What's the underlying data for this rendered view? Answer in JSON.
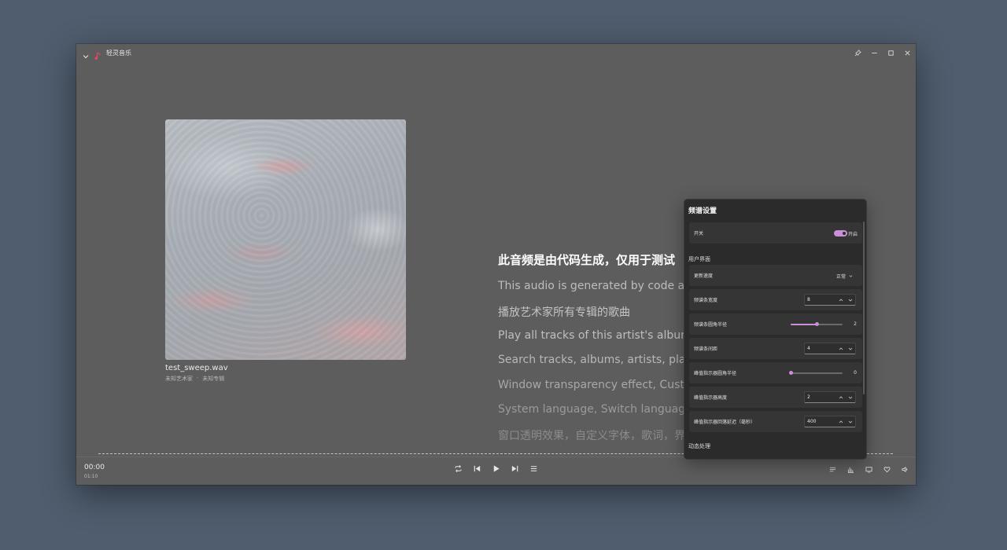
{
  "app": {
    "title": "轻灵音乐"
  },
  "track": {
    "name": "test_sweep.wav",
    "artist": "未知艺术家",
    "separator": "·",
    "album": "未知专辑"
  },
  "lyrics": [
    "此音频是由代码生成，仅用于测试",
    "This audio is generated by code and is",
    "播放艺术家所有专辑的歌曲",
    "Play all tracks of this artist's albums",
    "Search tracks, albums, artists, playlists",
    "Window transparency effect, Custom f",
    "System language, Switch language",
    "窗口透明效果，自定义字体，歌词，界面"
  ],
  "player": {
    "current_time": "00:00",
    "total_time": "01:10"
  },
  "panel": {
    "title": "频谱设置",
    "toggle": {
      "label": "开关",
      "state_text": "开启",
      "on": true
    },
    "section_ui": "用户界面",
    "update_speed": {
      "label": "更新速度",
      "value": "正常"
    },
    "bar_width": {
      "label": "频谱条宽度",
      "value": "8"
    },
    "bar_radius": {
      "label": "频谱条圆角半径",
      "value": "2",
      "fraction": 0.5
    },
    "bar_spacing": {
      "label": "频谱条间距",
      "value": "4"
    },
    "peak_radius": {
      "label": "峰值指示器圆角半径",
      "value": "0",
      "fraction": 0.0
    },
    "peak_height": {
      "label": "峰值指示器高度",
      "value": "2"
    },
    "peak_delay": {
      "label": "峰值指示器回落延迟（毫秒）",
      "value": "400"
    },
    "section_dynamic": "动态处理"
  },
  "colors": {
    "accent": "#c990d6",
    "panel_bg": "#2b2b2b",
    "window_bg": "#5d5d5d"
  },
  "icons": {
    "titlebar": [
      "chevron-down-icon",
      "music-note-icon",
      "pin-icon",
      "minimize-icon",
      "maximize-icon",
      "close-icon"
    ],
    "controls": [
      "repeat-icon",
      "previous-icon",
      "play-icon",
      "next-icon",
      "playlist-icon"
    ],
    "right": [
      "lyrics-icon",
      "spectrum-icon",
      "screen-icon",
      "heart-icon",
      "volume-icon"
    ]
  }
}
